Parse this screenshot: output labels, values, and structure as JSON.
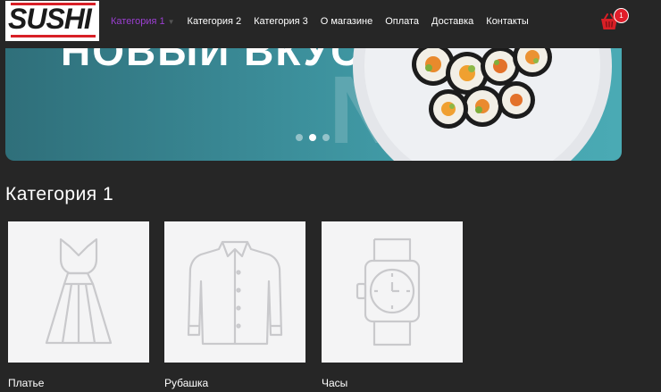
{
  "logo": {
    "text": "SUSHI"
  },
  "nav": {
    "items": [
      {
        "label": "Категория 1",
        "active": true
      },
      {
        "label": "Категория 2"
      },
      {
        "label": "Категория 3"
      },
      {
        "label": "О магазине"
      },
      {
        "label": "Оплата"
      },
      {
        "label": "Доставка"
      },
      {
        "label": "Контакты"
      }
    ],
    "dropdown_icon": "chevron-down-icon"
  },
  "cart": {
    "icon": "basket-icon",
    "count": "1"
  },
  "banner": {
    "headline": "НОВЫЙ ВКУС",
    "background_text": "NEW",
    "slides_total": 3,
    "active_slide": 2
  },
  "section": {
    "title": "Категория 1"
  },
  "products": [
    {
      "name": "Платье",
      "icon": "dress-icon"
    },
    {
      "name": "Рубашка",
      "icon": "shirt-icon"
    },
    {
      "name": "Часы",
      "icon": "watch-icon"
    }
  ],
  "colors": {
    "background": "#262626",
    "accent": "#9b3fd1",
    "cart": "#d81f26",
    "banner": "#3a8a96"
  }
}
